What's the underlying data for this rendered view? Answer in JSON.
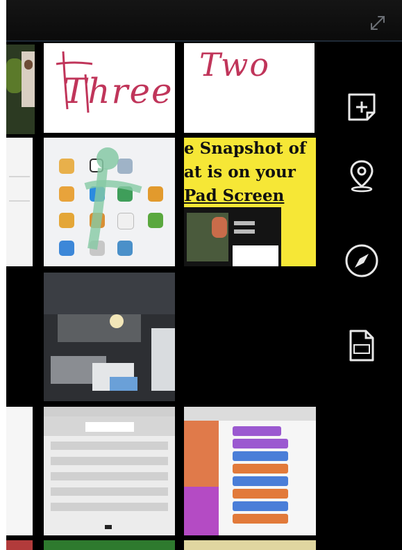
{
  "toolbar": {
    "expand_icon": "expand-arrows-icon"
  },
  "thumbnails": {
    "note_three": {
      "text": "Three",
      "ink_color": "#c0355a"
    },
    "note_two": {
      "text": "Two",
      "ink_color": "#c0355a"
    },
    "snapshot_slide": {
      "lines": [
        "e Snapshot of",
        "at is on your",
        "Pad Screen"
      ],
      "background": "#f6e736"
    }
  },
  "sidebar": {
    "buttons": [
      {
        "icon": "add-note-icon"
      },
      {
        "icon": "location-pin-icon"
      },
      {
        "icon": "compass-icon"
      },
      {
        "icon": "document-icon"
      }
    ]
  },
  "colors": {
    "background": "#000000",
    "tile_white": "#ffffff",
    "accent_yellow": "#f6e736",
    "ink": "#c0355a"
  }
}
